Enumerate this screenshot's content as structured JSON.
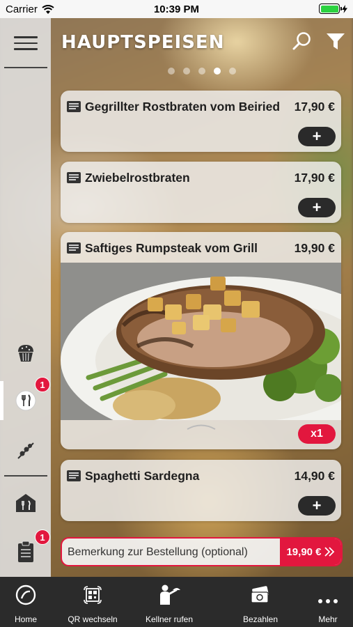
{
  "status_bar": {
    "carrier": "Carrier",
    "time": "10:39 PM"
  },
  "header": {
    "title": "HAUPTSPEISEN",
    "page_count": 5,
    "active_page": 4
  },
  "sidebar": {
    "items": [
      {
        "icon": "muffin-icon",
        "badge": ""
      },
      {
        "icon": "fork-knife-icon",
        "badge": "1",
        "active": true
      },
      {
        "icon": "skewer-icon",
        "badge": ""
      },
      {
        "icon": "restaurant-icon",
        "badge": ""
      },
      {
        "icon": "clipboard-icon",
        "badge": "1"
      }
    ]
  },
  "menu_items": [
    {
      "name": "Gegrillter Rostbraten vom Beiried",
      "price": "17,90 €",
      "action": "+"
    },
    {
      "name": "Zwiebelrostbraten",
      "price": "17,90 €",
      "action": "+"
    },
    {
      "name": "Saftiges Rumpsteak vom Grill",
      "price": "19,90 €",
      "action": "x1"
    },
    {
      "name": "Spaghetti Sardegna",
      "price": "14,90 €",
      "action": "+"
    }
  ],
  "order": {
    "remark_placeholder": "Bemerkung zur Bestellung (optional)",
    "total": "19,90 €"
  },
  "tabs": [
    {
      "label": "Home",
      "icon": "home-icon"
    },
    {
      "label": "QR wechseln",
      "icon": "qr-icon"
    },
    {
      "label": "Kellner rufen",
      "icon": "waiter-icon"
    },
    {
      "label": "Bezahlen",
      "icon": "pay-icon"
    },
    {
      "label": "Mehr",
      "icon": "more-icon"
    }
  ],
  "colors": {
    "accent": "#e2173e",
    "dark": "#2a2a2a",
    "tabbar": "#2b2b2b"
  }
}
